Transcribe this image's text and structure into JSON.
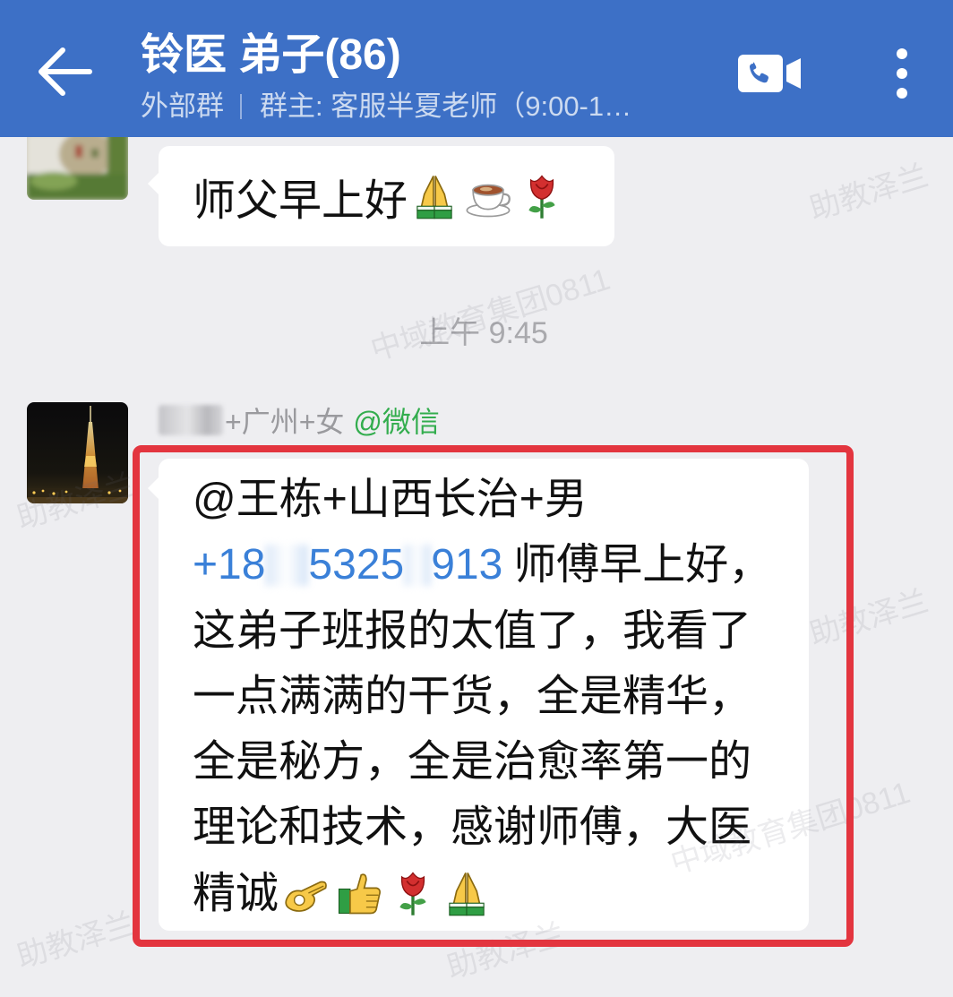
{
  "header": {
    "title": "铃医 弟子(86)",
    "group_type": "外部群",
    "owner": "群主: 客服半夏老师（9:00-1…",
    "icons": [
      "back-arrow-icon",
      "video-call-icon",
      "more-icon"
    ]
  },
  "colors": {
    "header_bg": "#3d70c6",
    "chat_bg": "#eeeef1",
    "bubble_bg": "#ffffff",
    "link_blue": "#3a80d8",
    "source_green": "#33ad4e",
    "highlight_red": "#e3353f"
  },
  "messages": [
    {
      "text": "师父早上好",
      "emoji": [
        "pray-emoji",
        "coffee-emoji",
        "rose-emoji"
      ]
    }
  ],
  "time_divider": "上午 9:45",
  "message_2": {
    "sender_name": "+广州+女",
    "sender_source": "@微信",
    "mention": "@王栋+山西长治+男",
    "phone_parts": [
      "+18",
      "5325",
      "913"
    ],
    "greeting": "师傅早上好，",
    "lines": [
      "这弟子班报的太值了，我看了",
      "一点满满的干货，全是精华，",
      "全是秘方，全是治愈率第一的",
      "理论和技术，感谢师傅，大医"
    ],
    "closing_text": "精诚",
    "closing_emoji": [
      "ok-hand-emoji",
      "thumbs-up-emoji",
      "rose-emoji",
      "pray-emoji"
    ]
  },
  "watermark": [
    "助教泽兰",
    "中域教育集团0811"
  ]
}
